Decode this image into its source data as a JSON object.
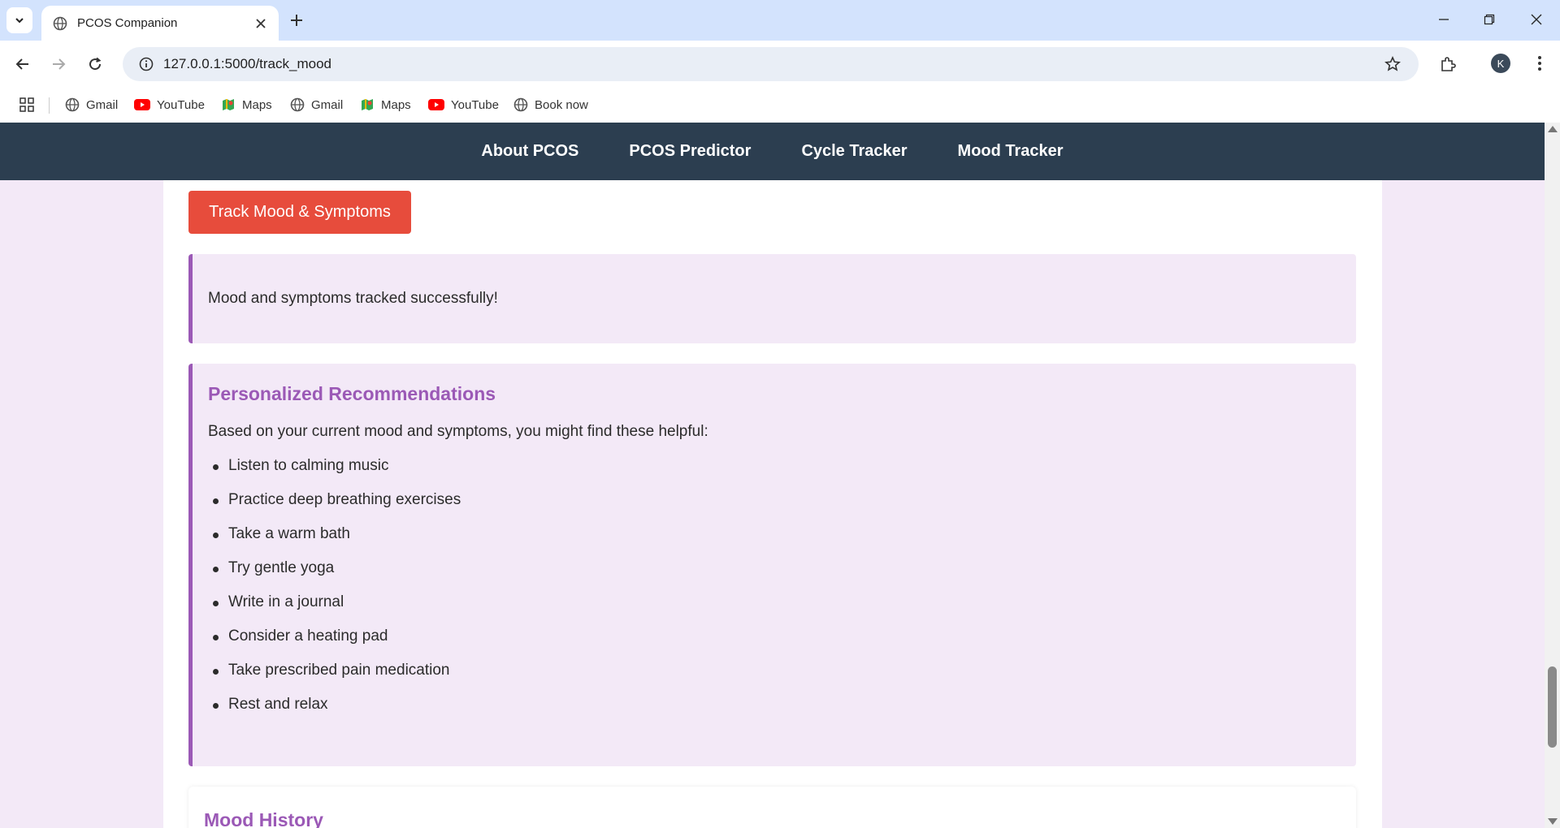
{
  "browser": {
    "tab_title": "PCOS Companion",
    "url": "127.0.0.1:5000/track_mood",
    "profile_initial": "K",
    "bookmarks": [
      {
        "label": "Gmail",
        "icon": "globe-icon"
      },
      {
        "label": "YouTube",
        "icon": "youtube-icon"
      },
      {
        "label": "Maps",
        "icon": "maps-icon"
      },
      {
        "label": "Gmail",
        "icon": "globe-icon"
      },
      {
        "label": "Maps",
        "icon": "maps-icon"
      },
      {
        "label": "YouTube",
        "icon": "youtube-icon"
      },
      {
        "label": "Book now",
        "icon": "globe-icon"
      }
    ]
  },
  "nav": {
    "items": [
      "About PCOS",
      "PCOS Predictor",
      "Cycle Tracker",
      "Mood Tracker"
    ]
  },
  "form": {
    "submit_label": "Track Mood & Symptoms"
  },
  "alert": {
    "message": "Mood and symptoms tracked successfully!"
  },
  "recommendations": {
    "title": "Personalized Recommendations",
    "intro": "Based on your current mood and symptoms, you might find these helpful:",
    "items": [
      "Listen to calming music",
      "Practice deep breathing exercises",
      "Take a warm bath",
      "Try gentle yoga",
      "Write in a journal",
      "Consider a heating pad",
      "Take prescribed pain medication",
      "Rest and relax"
    ]
  },
  "history": {
    "title": "Mood History"
  },
  "colors": {
    "nav_bg": "#2c3e50",
    "accent_purple": "#9b59b6",
    "button_red": "#e74c3c",
    "page_bg": "#f3e9f7"
  }
}
